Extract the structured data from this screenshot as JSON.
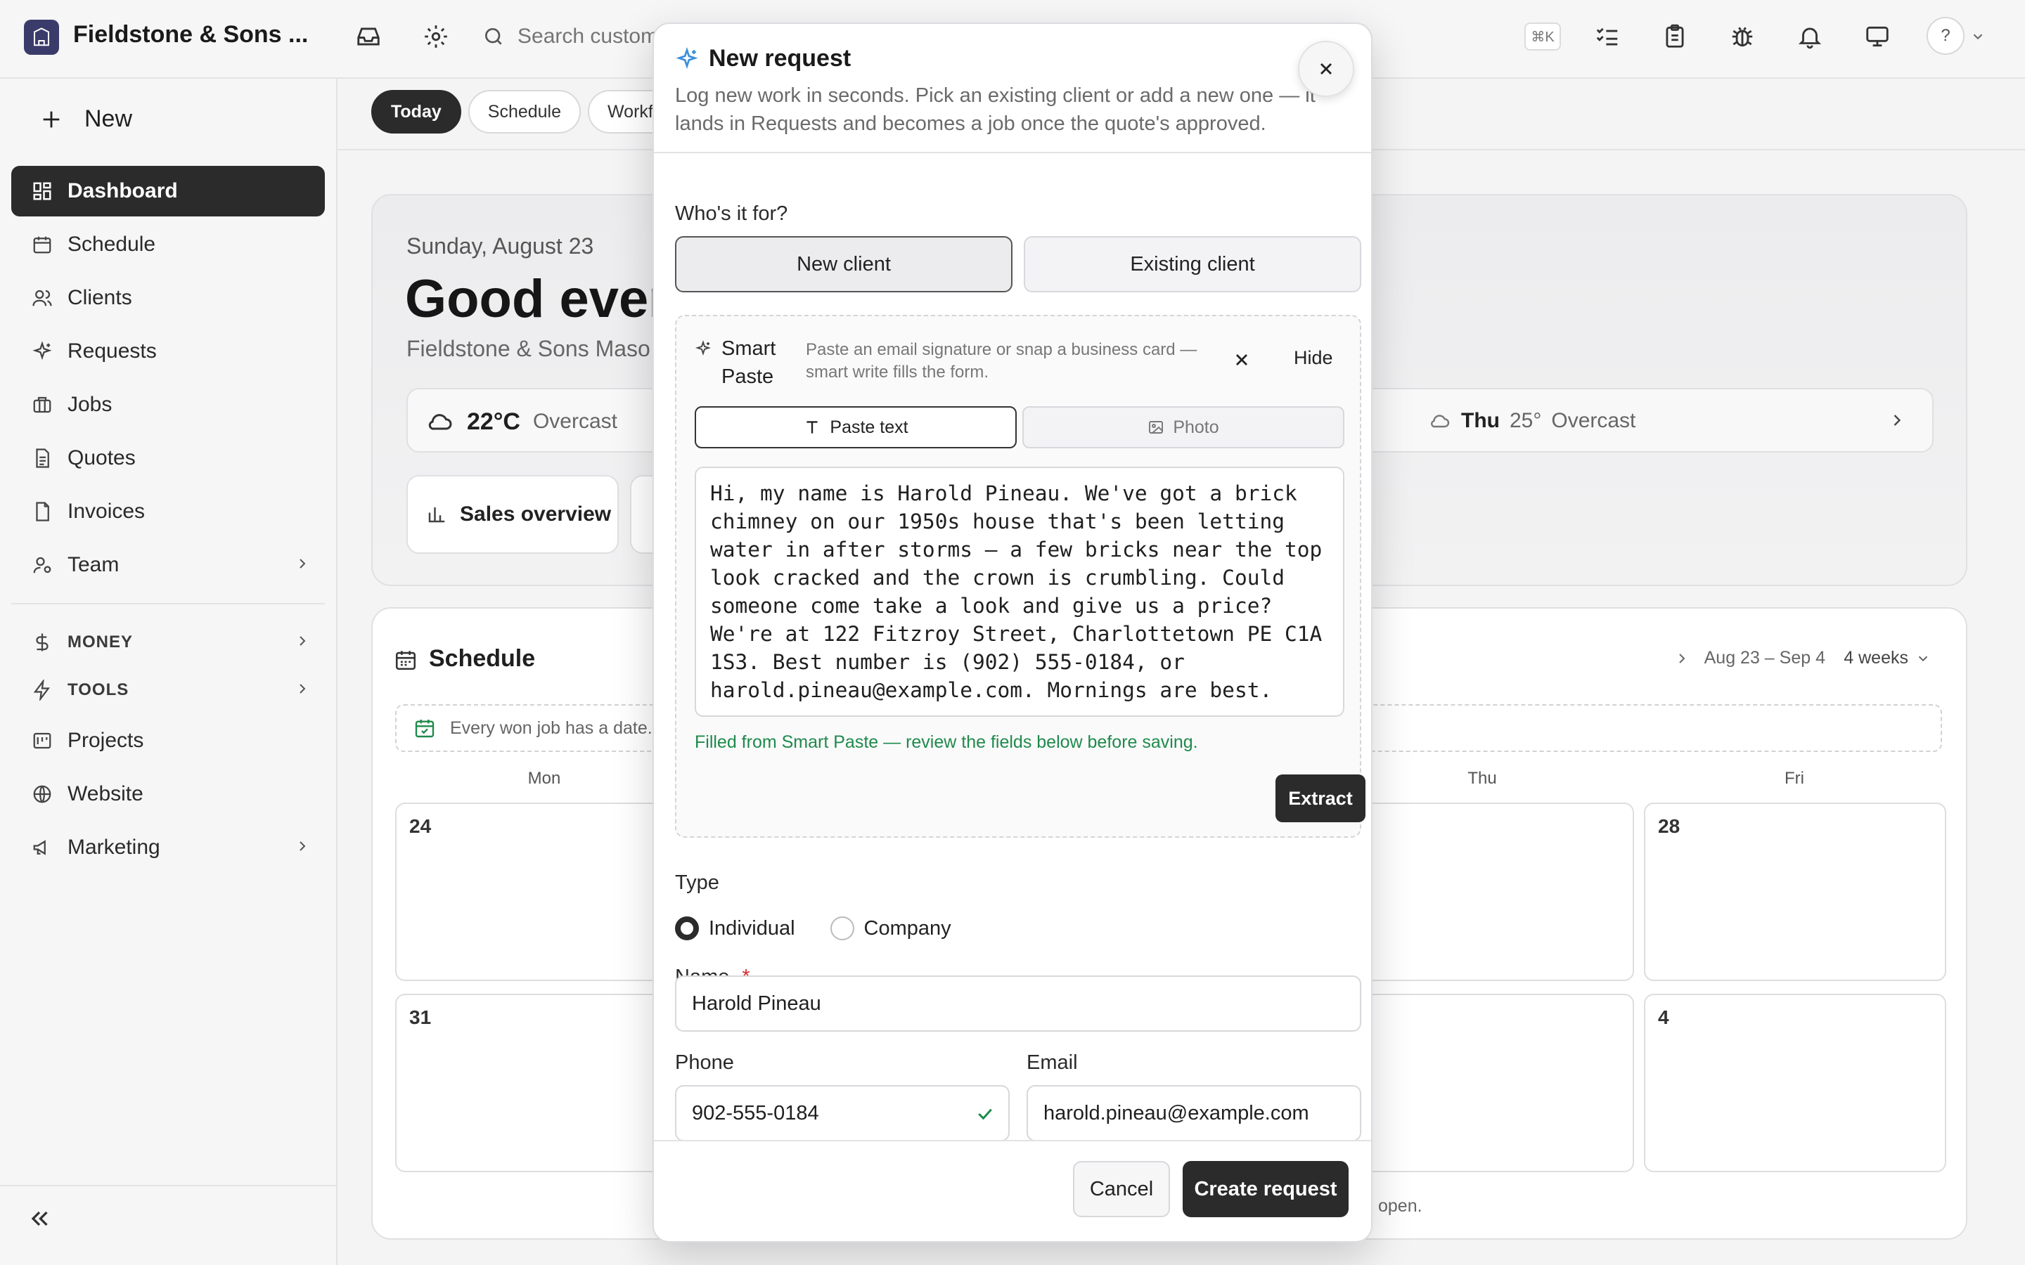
{
  "topbar": {
    "company": "Fieldstone & Sons ...",
    "search_placeholder": "Search customers",
    "shortcut": "⌘K",
    "help": "?"
  },
  "sidebar": {
    "new_label": "New",
    "items": [
      {
        "label": "Dashboard",
        "icon": "dashboard-icon"
      },
      {
        "label": "Schedule",
        "icon": "calendar-icon"
      },
      {
        "label": "Clients",
        "icon": "users-icon"
      },
      {
        "label": "Requests",
        "icon": "sparkle-icon"
      },
      {
        "label": "Jobs",
        "icon": "briefcase-icon"
      },
      {
        "label": "Quotes",
        "icon": "document-icon"
      },
      {
        "label": "Invoices",
        "icon": "invoice-icon"
      },
      {
        "label": "Team",
        "icon": "team-icon"
      }
    ],
    "sections": [
      {
        "label": "MONEY",
        "icon": "dollar-icon"
      },
      {
        "label": "TOOLS",
        "icon": "bolt-icon"
      }
    ],
    "more": [
      {
        "label": "Projects",
        "icon": "projects-icon"
      },
      {
        "label": "Website",
        "icon": "globe-icon"
      },
      {
        "label": "Marketing",
        "icon": "megaphone-icon"
      }
    ]
  },
  "tabs": [
    "Today",
    "Schedule",
    "Workfl"
  ],
  "hero": {
    "date": "Sunday, August 23",
    "greeting": "Good even",
    "subtitle": "Fieldstone & Sons Maso",
    "weather_temp": "22°C",
    "weather_cond": "Overcast",
    "forecast_day": "Thu",
    "forecast_temp": "25°",
    "forecast_cond": "Overcast",
    "sales_label": "Sales overview"
  },
  "schedule": {
    "title": "Schedule",
    "range": "Aug 23 – Sep 4",
    "weeks": "4 weeks",
    "notice": "Every won job has a date.",
    "days": [
      "Mon",
      "Thu",
      "Fri"
    ],
    "dates": [
      "24",
      "28",
      "31",
      "4"
    ],
    "footer": "open."
  },
  "modal": {
    "title": "New request",
    "description": "Log new work in seconds. Pick an existing client or add a new one — it lands in Requests and becomes a job once the quote's approved.",
    "who_label": "Who's it for?",
    "new_client": "New client",
    "existing_client": "Existing client",
    "smart_paste": {
      "title": "Smart Paste",
      "description": "Paste an email signature or snap a business card — smart write fills the form.",
      "hide": "Hide",
      "paste_text": "Paste text",
      "photo": "Photo",
      "text": "Hi, my name is Harold Pineau. We've got a brick chimney on our 1950s house that's been letting water in after storms — a few bricks near the top look cracked and the crown is crumbling. Could someone come take a look and give us a price? We're at 122 Fitzroy Street, Charlottetown PE C1A 1S3. Best number is (902) 555-0184, or harold.pineau@example.com. Mornings are best.",
      "filled_note": "Filled from Smart Paste — review the fields below before saving.",
      "extract": "Extract"
    },
    "type_label": "Type",
    "type_individual": "Individual",
    "type_company": "Company",
    "name_label": "Name",
    "required_mark": "*",
    "name_value": "Harold Pineau",
    "phone_label": "Phone",
    "phone_value": "902-555-0184",
    "email_label": "Email",
    "email_value": "harold.pineau@example.com",
    "cancel": "Cancel",
    "create": "Create request"
  },
  "colors": {
    "accent_dark": "#2b2b2b",
    "success_green": "#1f8a4c",
    "sparkle_blue": "#3b8fd9",
    "required_red": "#d32f2f"
  }
}
